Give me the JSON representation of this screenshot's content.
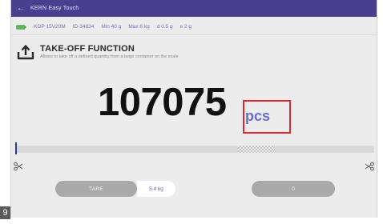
{
  "window": {
    "title": "KERN Easy Touch",
    "back_icon": "arrow-left-icon"
  },
  "info_bar": {
    "battery_icon": "battery-icon",
    "model": "KGP 15V20M",
    "id": "ID-34834",
    "min": "Min 40 g",
    "max": "Max 6 kg",
    "d": "d 0.5 g",
    "e": "e 2 g"
  },
  "function": {
    "icon": "upload-icon",
    "title": "TAKE-OFF FUNCTION",
    "description": "Allows to take off a defined quantity from a large container on the scale"
  },
  "readout": {
    "value": "107075",
    "unit": "pcs"
  },
  "progress": {
    "level": 0.0,
    "target_window_start": 0.62,
    "target_window_end": 0.72
  },
  "buttons": {
    "tare_label": "TARE",
    "tare_value": "5.4 kg",
    "zero_label": "0"
  },
  "figure_number": "9",
  "colors": {
    "titlebar": "#4a3e8f",
    "accent": "#6a6ecf",
    "highlight_box": "#e0262e",
    "progress_marker": "#1e3f9e"
  }
}
